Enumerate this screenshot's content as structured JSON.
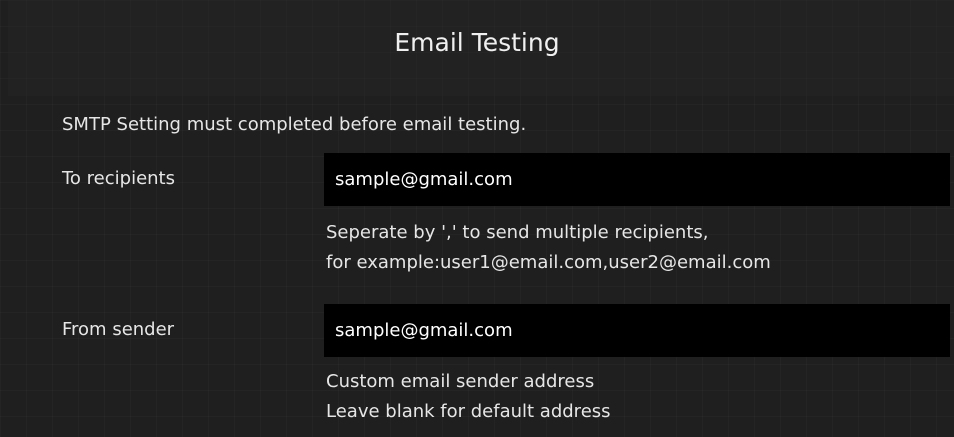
{
  "header": {
    "title": "Email Testing"
  },
  "notice": "SMTP Setting must completed before email testing.",
  "form": {
    "recipients": {
      "label": "To recipients",
      "value": "sample@gmail.com",
      "hint_line1": "Seperate by ',' to send multiple recipients,",
      "hint_line2": "for example:user1@email.com,user2@email.com"
    },
    "sender": {
      "label": "From sender",
      "value": "sample@gmail.com",
      "hint_line1": "Custom email sender address",
      "hint_line2": "Leave blank for default address"
    }
  },
  "colors": {
    "background": "#1f1f1f",
    "field_background": "#000000",
    "text": "#e6e6e6"
  }
}
